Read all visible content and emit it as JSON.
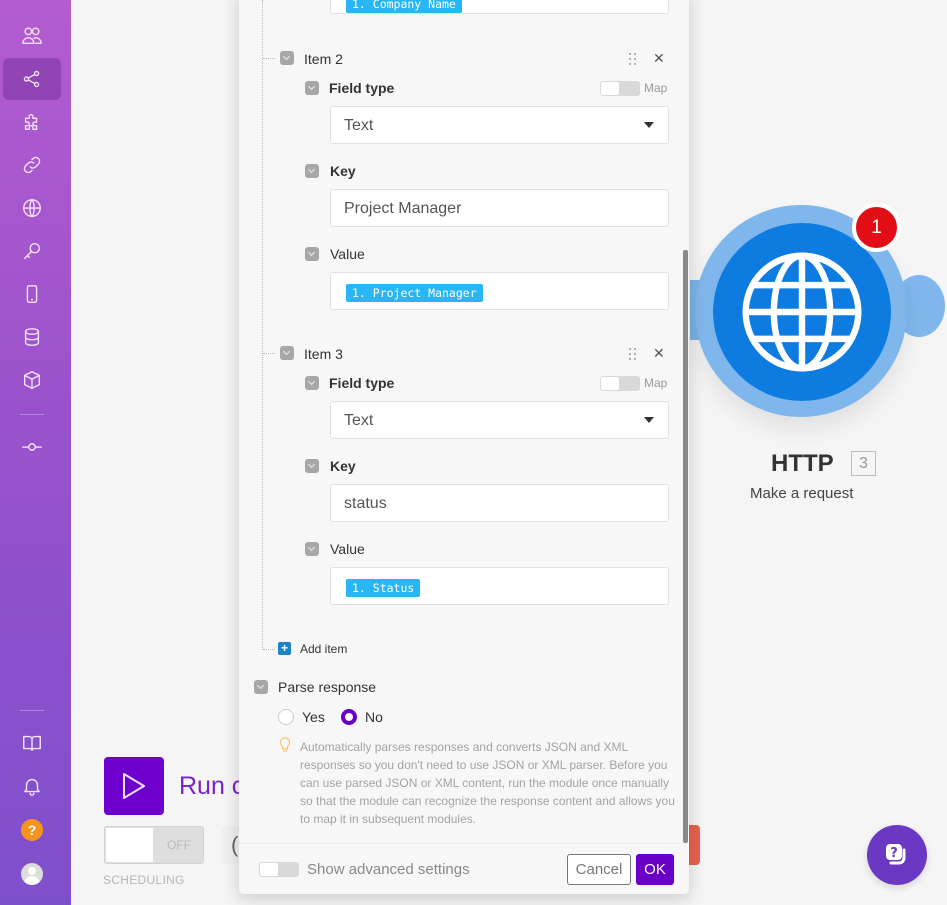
{
  "sidebar": {
    "items": [
      {
        "name": "team",
        "icon": "users-icon"
      },
      {
        "name": "scenarios",
        "icon": "share-nodes-icon",
        "active": true
      },
      {
        "name": "templates",
        "icon": "puzzle-icon"
      },
      {
        "name": "connections",
        "icon": "link-icon"
      },
      {
        "name": "webhooks",
        "icon": "globe-icon"
      },
      {
        "name": "keys",
        "icon": "key-icon"
      },
      {
        "name": "devices",
        "icon": "mobile-icon"
      },
      {
        "name": "data-stores",
        "icon": "database-icon"
      },
      {
        "name": "data-structures",
        "icon": "cube-icon"
      },
      {
        "name": "custom-apps",
        "icon": "commit-icon"
      }
    ],
    "bottom": [
      {
        "name": "documentation",
        "icon": "book-icon"
      },
      {
        "name": "notifications",
        "icon": "bell-icon"
      },
      {
        "name": "help",
        "icon": "question-icon",
        "label": "?"
      },
      {
        "name": "profile",
        "icon": "avatar-icon"
      }
    ]
  },
  "scenario": {
    "run_label": "Run c",
    "scheduling_toggle": "OFF",
    "scheduling_label": "SCHEDULING",
    "partial_control": "("
  },
  "module": {
    "title": "HTTP",
    "number": "3",
    "subtitle": "Make a request",
    "badge": "1",
    "color": "#0e7be0"
  },
  "panel": {
    "top_chip": "1. Company Name",
    "items": [
      {
        "label": "Item 2",
        "field_type_label": "Field type",
        "map_label": "Map",
        "field_type_value": "Text",
        "key_label": "Key",
        "key_value": "Project Manager",
        "value_label": "Value",
        "value_chip": "1. Project Manager"
      },
      {
        "label": "Item 3",
        "field_type_label": "Field type",
        "map_label": "Map",
        "field_type_value": "Text",
        "key_label": "Key",
        "key_value": "status",
        "value_label": "Value",
        "value_chip": "1. Status"
      }
    ],
    "add_item": "Add item",
    "parse_response": {
      "label": "Parse response",
      "options": [
        "Yes",
        "No"
      ],
      "selected": "No",
      "hint": "Automatically parses responses and converts JSON and XML responses so you don't need to use JSON or XML parser. Before you can use parsed JSON or XML content, run the module once manually so that the module can recognize the response content and allows you to map it in subsequent modules."
    },
    "footer": {
      "advanced_label": "Show advanced settings",
      "cancel": "Cancel",
      "ok": "OK"
    }
  },
  "colors": {
    "accent": "#6a00c8",
    "chip": "#29b6f6",
    "badge": "#e10e16",
    "help": "#f5931e"
  }
}
